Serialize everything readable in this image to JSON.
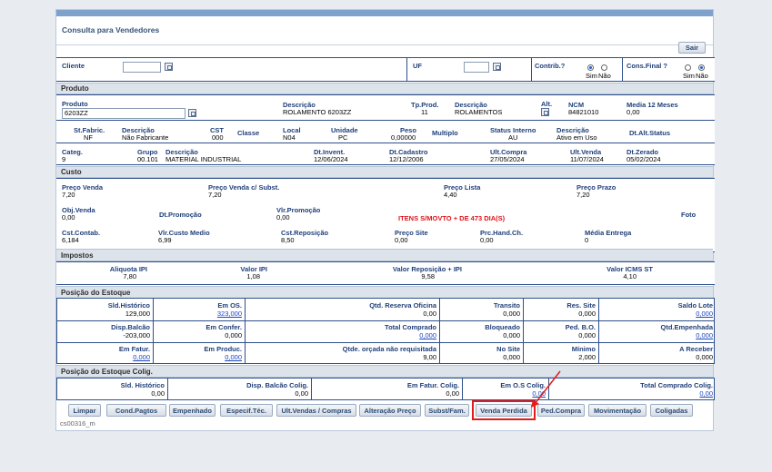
{
  "title": "Consulta para Vendedores",
  "sair": "Sair",
  "cliente": "Cliente",
  "uf": "UF",
  "contrib": {
    "label": "Contrib.?",
    "sim": "Sim",
    "nao": "Não"
  },
  "consfinal": {
    "label": "Cons.Final ?",
    "sim": "Sim",
    "nao": "Não"
  },
  "sections": {
    "produto": "Produto",
    "custo": "Custo",
    "impostos": "Impostos",
    "estoque": "Posição do Estoque",
    "colig": "Posição do Estoque Colig."
  },
  "produto": {
    "produto_lbl": "Produto",
    "produto_val": "6203ZZ",
    "descricao_lbl": "Descrição",
    "descricao_val": "ROLAMENTO 6203ZZ",
    "tpprod_lbl": "Tp.Prod.",
    "tpprod_val": "11",
    "descricao2_lbl": "Descrição",
    "descricao2_val": "ROLAMENTOS",
    "alt_lbl": "Alt.",
    "ncm_lbl": "NCM",
    "ncm_val": "84821010",
    "media_lbl": "Media 12 Meses",
    "media_val": "0,00",
    "stfabric_lbl": "St.Fabric.",
    "stfabric_val": "NF",
    "descfab_lbl": "Descrição",
    "descfab_val": "Não Fabricante",
    "cst_lbl": "CST",
    "cst_val": "000",
    "classe_lbl": "Classe",
    "local_lbl": "Local",
    "local_val": "N04",
    "unidade_lbl": "Unidade",
    "unidade_val": "PC",
    "peso_lbl": "Peso",
    "peso_val": "0,00000",
    "multiplo_lbl": "Multiplo",
    "status_lbl": "Status Interno",
    "status_val": "AU",
    "descstatus_lbl": "Descrição",
    "descstatus_val": "Ativo em Uso",
    "dtalt_lbl": "Dt.Alt.Status",
    "categ_lbl": "Categ.",
    "categ_val": "9",
    "grupo_lbl": "Grupo",
    "grupo_val": "00.101",
    "descgrupo_lbl": "Descrição",
    "descgrupo_val": "MATERIAL INDUSTRIAL",
    "dtinvent_lbl": "Dt.Invent.",
    "dtinvent_val": "12/06/2024",
    "dtcadastro_lbl": "Dt.Cadastro",
    "dtcadastro_val": "12/12/2006",
    "ultcompra_lbl": "Ult.Compra",
    "ultcompra_val": "27/05/2024",
    "ultvenda_lbl": "Ult.Venda",
    "ultvenda_val": "11/07/2024",
    "dtzerado_lbl": "Dt.Zerado",
    "dtzerado_val": "05/02/2024"
  },
  "custo": {
    "precovenda_lbl": "Preço Venda",
    "precovenda_val": "7,20",
    "precovendasubst_lbl": "Preço Venda c/ Subst.",
    "precovendasubst_val": "7,20",
    "precolista_lbl": "Preço Lista",
    "precolista_val": "4,40",
    "precoprazo_lbl": "Preço Prazo",
    "precoprazo_val": "7,20",
    "objvenda_lbl": "Obj.Venda",
    "objvenda_val": "0,00",
    "dtpromo_lbl": "Dt.Promoção",
    "vlrpromo_lbl": "Vlr.Promoção",
    "vlrpromo_val": "0,00",
    "warning": "ITENS S/MOVTO + DE 473 DIA(S)",
    "foto_lbl": "Foto",
    "cstcontab_lbl": "Cst.Contab.",
    "cstcontab_val": "6,184",
    "vlrcusto_lbl": "Vlr.Custo Medio",
    "vlrcusto_val": "6,99",
    "cstrepos_lbl": "Cst.Reposição",
    "cstrepos_val": "8,50",
    "precosite_lbl": "Preço Site",
    "precosite_val": "0,00",
    "prchand_lbl": "Prc.Hand.Ch.",
    "prchand_val": "0,00",
    "mediaentrega_lbl": "Média Entrega",
    "mediaentrega_val": "0"
  },
  "impostos": {
    "aliq_lbl": "Aliquota IPI",
    "aliq_val": "7,80",
    "valoripi_lbl": "Valor IPI",
    "valoripi_val": "1,08",
    "valorrep_lbl": "Valor Reposição + IPI",
    "valorrep_val": "9,58",
    "valoricms_lbl": "Valor ICMS ST",
    "valoricms_val": "4,10"
  },
  "estoque": [
    [
      {
        "l": "Sld.Histórico",
        "v": "129,000",
        "link": false
      },
      {
        "l": "Em OS.",
        "v": "323,000",
        "link": true
      },
      {
        "l": "Qtd. Reserva Oficina",
        "v": "0,00",
        "link": false
      },
      {
        "l": "Transito",
        "v": "0,000",
        "link": false
      },
      {
        "l": "Res. Site",
        "v": "0,000",
        "link": false
      },
      {
        "l": "Saldo Lote",
        "v": "0,000",
        "link": true
      }
    ],
    [
      {
        "l": "Disp.Balcão",
        "v": "-203,000",
        "link": false
      },
      {
        "l": "Em Confer.",
        "v": "0,000",
        "link": false
      },
      {
        "l": "Total Comprado",
        "v": "0,000",
        "link": true
      },
      {
        "l": "Bloqueado",
        "v": "0,000",
        "link": false
      },
      {
        "l": "Ped. B.O.",
        "v": "0,000",
        "link": false
      },
      {
        "l": "Qtd.Empenhada",
        "v": "0,000",
        "link": true
      }
    ],
    [
      {
        "l": "Em Fatur.",
        "v": "0,000",
        "link": true
      },
      {
        "l": "Em Produc.",
        "v": "0,000",
        "link": true
      },
      {
        "l": "Qtde. orçada não requisitada",
        "v": "9,00",
        "link": false
      },
      {
        "l": "No Site",
        "v": "0,000",
        "link": false
      },
      {
        "l": "Mínimo",
        "v": "2,000",
        "link": false
      },
      {
        "l": "A Receber",
        "v": "0,000",
        "link": false
      }
    ]
  ],
  "colig": [
    {
      "l": "Sld. Histórico",
      "v": "0,00",
      "link": false
    },
    {
      "l": "Disp. Balcão Colig.",
      "v": "0,00",
      "link": false
    },
    {
      "l": "Em Fatur. Colig.",
      "v": "0,00",
      "link": false
    },
    {
      "l": "Em O.S Colig.",
      "v": "0,00",
      "link": true
    },
    {
      "l": "Total Comprado Colig.",
      "v": "0,00",
      "link": true
    }
  ],
  "buttons": [
    "Limpar",
    "Cond.Pagtos",
    "Empenhado",
    "Especif.Téc.",
    "Ult.Vendas / Compras",
    "Alteração Preço",
    "Subst/Fam.",
    "Venda Perdida",
    "Ped.Compra",
    "Movimentação",
    "Coligadas"
  ],
  "footer": "cs00316_m"
}
